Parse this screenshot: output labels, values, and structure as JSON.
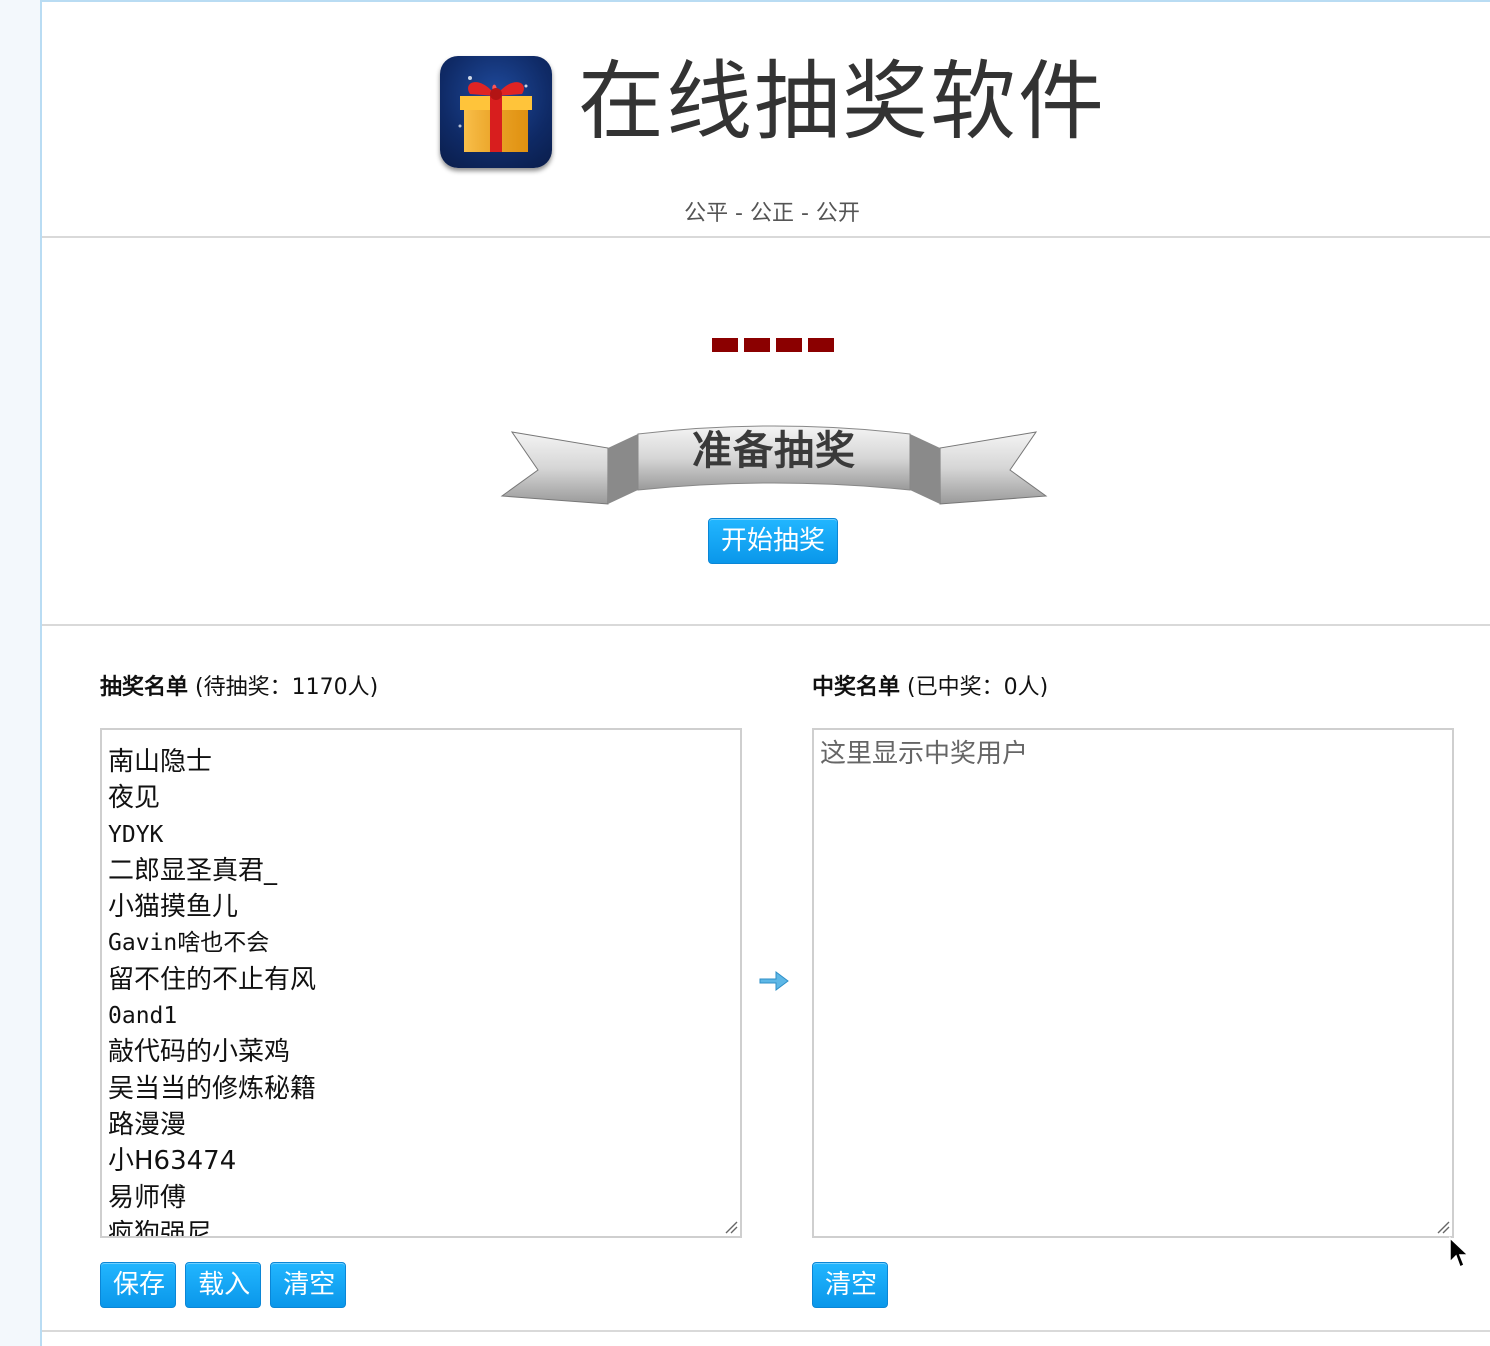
{
  "header": {
    "title": "在线抽奖软件",
    "subtitle": "公平 - 公正 - 公开",
    "logo_icon": "gift-box-icon"
  },
  "draw": {
    "banner_text": "准备抽奖",
    "start_button": "开始抽奖",
    "display_color": "#8b0000"
  },
  "candidates": {
    "heading_bold": "抽奖名单",
    "heading_count": "(待抽奖：1170人)",
    "names": [
      "南山隐士",
      "夜见",
      "YDYK",
      "二郎显圣真君_",
      "小猫摸鱼儿",
      "Gavin啥也不会",
      "留不住的不止有风",
      "0and1",
      "敲代码的小菜鸡",
      "吴当当的修炼秘籍",
      "路漫漫",
      "小H63474",
      "易师傅",
      "疯狗强尼"
    ],
    "buttons": {
      "save": "保存",
      "load": "载入",
      "clear": "清空"
    }
  },
  "winners": {
    "heading_bold": "中奖名单",
    "heading_count": "(已中奖：0人)",
    "placeholder": "这里显示中奖用户",
    "buttons": {
      "clear": "清空"
    }
  },
  "colors": {
    "accent": "#0a97ea",
    "frame_border": "#b9dcf3",
    "title_text": "#333333"
  },
  "icons": {
    "transfer": "arrow-right-icon",
    "resize": "resize-grip-icon",
    "cursor": "mouse-pointer-icon"
  }
}
